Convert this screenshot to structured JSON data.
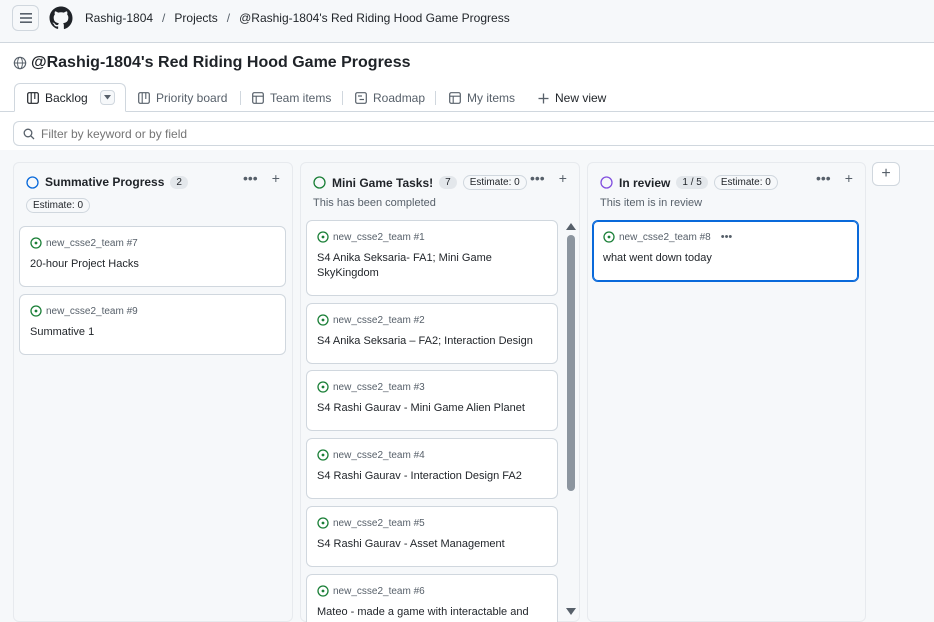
{
  "breadcrumbs": [
    "Rashig-1804",
    "Projects",
    "@Rashig-1804's Red Riding Hood Game Progress"
  ],
  "page_title": "@Rashig-1804's Red Riding Hood Game Progress",
  "tabs": [
    {
      "label": "Backlog",
      "icon": "board-icon"
    },
    {
      "label": "Priority board",
      "icon": "board-icon"
    },
    {
      "label": "Team items",
      "icon": "table-icon"
    },
    {
      "label": "Roadmap",
      "icon": "roadmap-icon"
    },
    {
      "label": "My items",
      "icon": "table-icon"
    }
  ],
  "new_view_label": "New view",
  "filter": {
    "placeholder": "Filter by keyword or by field"
  },
  "columns": [
    {
      "title": "Summative Progress",
      "count": "2",
      "estimate": "Estimate: 0",
      "description": "",
      "status_color": "#0969da",
      "cards": [
        {
          "meta": "new_csse2_team #7",
          "title": "20-hour Project Hacks"
        },
        {
          "meta": "new_csse2_team #9",
          "title": "Summative 1"
        }
      ]
    },
    {
      "title": "Mini Game Tasks!",
      "count": "7",
      "estimate": "Estimate: 0",
      "description": "This has been completed",
      "status_color": "#1a7f37",
      "cards": [
        {
          "meta": "new_csse2_team #1",
          "title": "S4 Anika Seksaria- FA1; Mini Game SkyKingdom"
        },
        {
          "meta": "new_csse2_team #2",
          "title": "S4 Anika Seksaria – FA2; Interaction Design"
        },
        {
          "meta": "new_csse2_team #3",
          "title": "S4 Rashi Gaurav - Mini Game Alien Planet"
        },
        {
          "meta": "new_csse2_team #4",
          "title": "S4 Rashi Gaurav - Interaction Design FA2"
        },
        {
          "meta": "new_csse2_team #5",
          "title": "S4 Rashi Gaurav - Asset Management"
        },
        {
          "meta": "new_csse2_team #6",
          "title": "Mateo - made a game with interactable and"
        }
      ]
    },
    {
      "title": "In review",
      "count": "1 / 5",
      "estimate": "Estimate: 0",
      "description": "This item is in review",
      "status_color": "#8250df",
      "cards": [
        {
          "meta": "new_csse2_team #8",
          "title": "what went down today"
        }
      ]
    }
  ],
  "colors": {
    "open_issue": "#1a7f37",
    "accent": "#0969da"
  }
}
